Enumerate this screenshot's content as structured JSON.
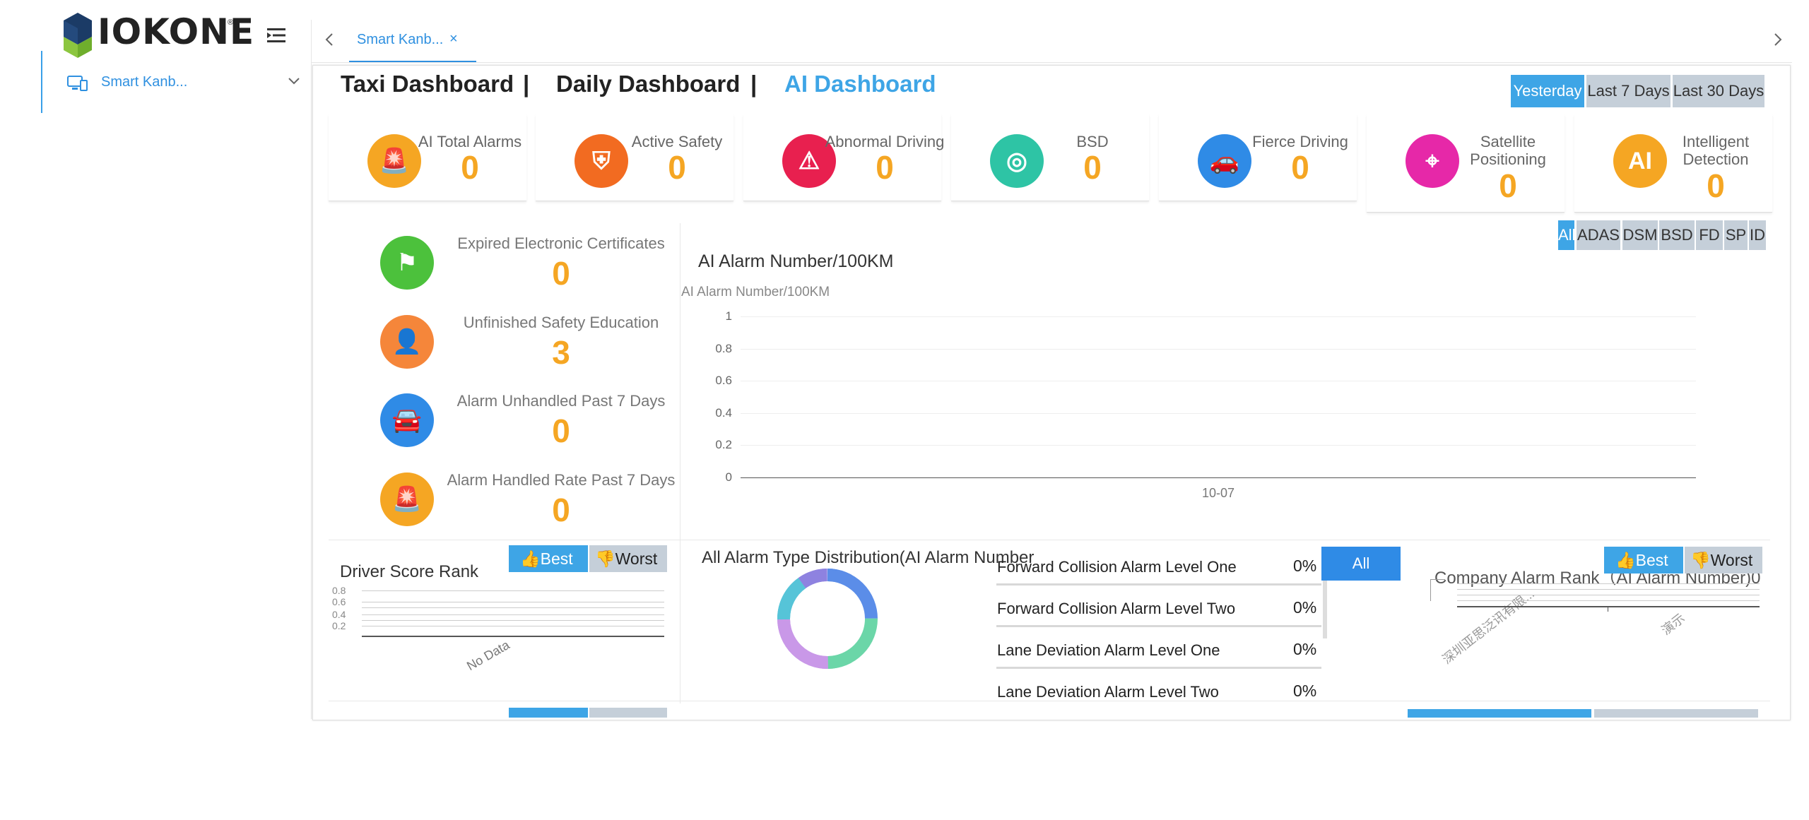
{
  "sidebar": {
    "logo_text": "IOKONE",
    "logo_reg": "®",
    "item_label": "Smart Kanb..."
  },
  "tabs": {
    "active_label": "Smart Kanb...",
    "close": "×"
  },
  "nav": {
    "taxi": "Taxi Dashboard",
    "sep": "|",
    "daily": "Daily Dashboard",
    "ai": "AI Dashboard"
  },
  "ranges": [
    "Yesterday",
    "Last 7 Days",
    "Last 30 Days"
  ],
  "cards": [
    {
      "title": "AI Total Alarms",
      "value": "0",
      "color": "#f5a623",
      "icon": "alarm-light-icon"
    },
    {
      "title": "Active Safety",
      "value": "0",
      "color": "#f26b21",
      "icon": "shield-icon"
    },
    {
      "title": "Abnormal Driving",
      "value": "0",
      "color": "#e8204f",
      "icon": "warning-icon"
    },
    {
      "title": "BSD",
      "value": "0",
      "color": "#2ec4a5",
      "icon": "eye-slash-icon"
    },
    {
      "title": "Fierce Driving",
      "value": "0",
      "color": "#2f8be6",
      "icon": "car-crash-icon"
    },
    {
      "title": "Satellite Positioning",
      "value": "0",
      "color": "#e628a8",
      "icon": "location-pin-icon"
    },
    {
      "title": "Intelligent Detection",
      "value": "0",
      "color": "#f5a623",
      "icon": "ai-brain-icon"
    }
  ],
  "left_stats": [
    {
      "title": "Expired Electronic Certificates",
      "value": "0",
      "color": "#4cc13c",
      "icon": "flag-icon"
    },
    {
      "title": "Unfinished Safety Education",
      "value": "3",
      "color": "#f5863a",
      "icon": "person-icon"
    },
    {
      "title": "Alarm Unhandled Past 7 Days",
      "value": "0",
      "color": "#2f8be6",
      "icon": "car-icon"
    },
    {
      "title": "Alarm Handled Rate Past 7 Days",
      "value": "0",
      "color": "#f5a623",
      "icon": "alarm-light-icon"
    }
  ],
  "filters": [
    "All",
    "ADAS",
    "DSM",
    "BSD",
    "FD",
    "SP",
    "ID"
  ],
  "chart_data": {
    "type": "line",
    "title": "AI Alarm Number/100KM",
    "ylabel": "AI Alarm Number/100KM",
    "categories": [
      "10-07"
    ],
    "series": [
      {
        "values": [
          0
        ]
      }
    ],
    "ylim": [
      0,
      1
    ],
    "yticks": [
      "1",
      "0.8",
      "0.6",
      "0.4",
      "0.2",
      "0"
    ],
    "grid": true
  },
  "driver_rank": {
    "title": "Driver Score Rank",
    "best": "Best",
    "worst": "Worst",
    "yticks": [
      "0.8",
      "0.6",
      "0.4",
      "0.2"
    ],
    "no_data": "No Data"
  },
  "alarm_dist": {
    "title": "All Alarm Type Distribution(AI Alarm Number",
    "all_btn": "All",
    "items": [
      {
        "label": "Forward Collision Alarm Level One",
        "value": "0%"
      },
      {
        "label": "Forward Collision Alarm Level Two",
        "value": "0%"
      },
      {
        "label": "Lane Deviation Alarm Level One",
        "value": "0%"
      },
      {
        "label": "Lane Deviation Alarm Level Two",
        "value": "0%"
      }
    ]
  },
  "company_rank": {
    "title": "Company Alarm Rank（AI Alarm Number)",
    "suffix": "0",
    "best": "Best",
    "worst": "Worst",
    "xlabels": [
      "深圳亚思泛讯有限...",
      "演示"
    ]
  }
}
